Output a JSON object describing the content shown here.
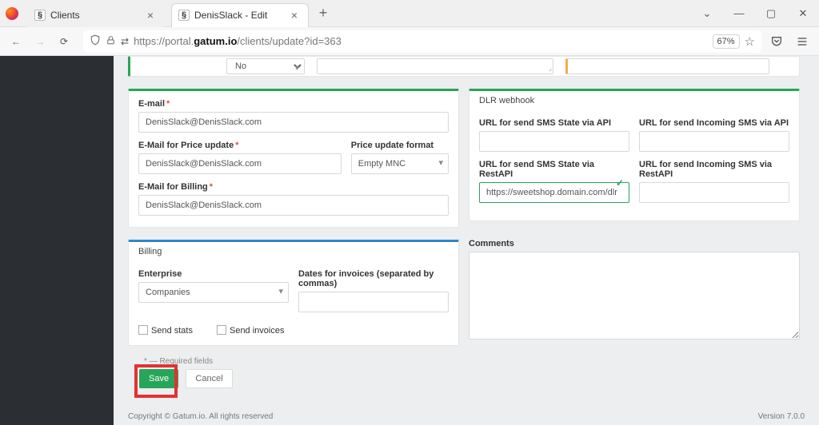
{
  "browser": {
    "tabs": [
      {
        "title": "Clients"
      },
      {
        "title": "DenisSlack - Edit"
      }
    ],
    "zoom": "67%",
    "url_host": "gatum.io",
    "url_prefix": "https://portal.",
    "url_path": "/clients/update?id=363"
  },
  "panels": {
    "top_select_value": "No",
    "email_label": "E-mail",
    "email_value": "DenisSlack@DenisSlack.com",
    "email_price_label": "E-Mail for Price update",
    "email_price_value": "DenisSlack@DenisSlack.com",
    "price_format_label": "Price update format",
    "price_format_value": "Empty MNC",
    "email_billing_label": "E-Mail for Billing",
    "email_billing_value": "DenisSlack@DenisSlack.com",
    "dlr_title": "DLR webhook",
    "dlr": {
      "url_sms_api": "URL for send SMS State via API",
      "url_inc_api": "URL for send Incoming SMS via API",
      "url_sms_rest": "URL for send SMS State via RestAPI",
      "url_inc_rest": "URL for send Incoming SMS via RestAPI",
      "rest_value": "https://sweetshop.domain.com/dlr"
    },
    "billing_title": "Billing",
    "enterprise_label": "Enterprise",
    "enterprise_value": "Companies",
    "dates_label": "Dates for invoices (separated by commas)",
    "send_stats": "Send stats",
    "send_invoices": "Send invoices",
    "comments_label": "Comments"
  },
  "footer": {
    "required_note": "* — Required fields",
    "save": "Save",
    "cancel": "Cancel",
    "copyright": "Copyright © Gatum.io. All rights reserved",
    "version": "Version 7.0.0"
  }
}
